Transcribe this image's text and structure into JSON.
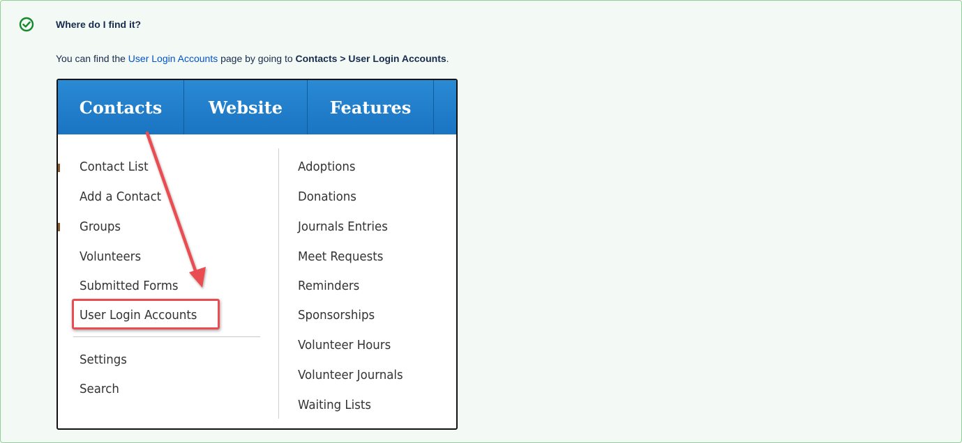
{
  "panel": {
    "icon": "check-circle-icon",
    "accent": "#14892c",
    "title": "Where do I find it?",
    "desc_before": "You can find the ",
    "desc_link": "User Login Accounts",
    "desc_middle": " page by going to ",
    "desc_path": "Contacts > User Login Accounts",
    "desc_after": "."
  },
  "nav": {
    "tabs": [
      "Contacts",
      "Website",
      "Features"
    ],
    "color": "#1a74c2"
  },
  "menu": {
    "left": [
      "Contact List",
      "Add a Contact",
      "Groups",
      "Volunteers",
      "Submitted Forms",
      "User Login Accounts"
    ],
    "left_bottom": [
      "Settings",
      "Search"
    ],
    "right": [
      "Adoptions",
      "Donations",
      "Journals Entries",
      "Meet Requests",
      "Reminders",
      "Sponsorships",
      "Volunteer Hours",
      "Volunteer Journals",
      "Waiting Lists"
    ]
  },
  "annotation": {
    "arrow_color": "#ea4d51",
    "highlighted_item": "User Login Accounts"
  }
}
